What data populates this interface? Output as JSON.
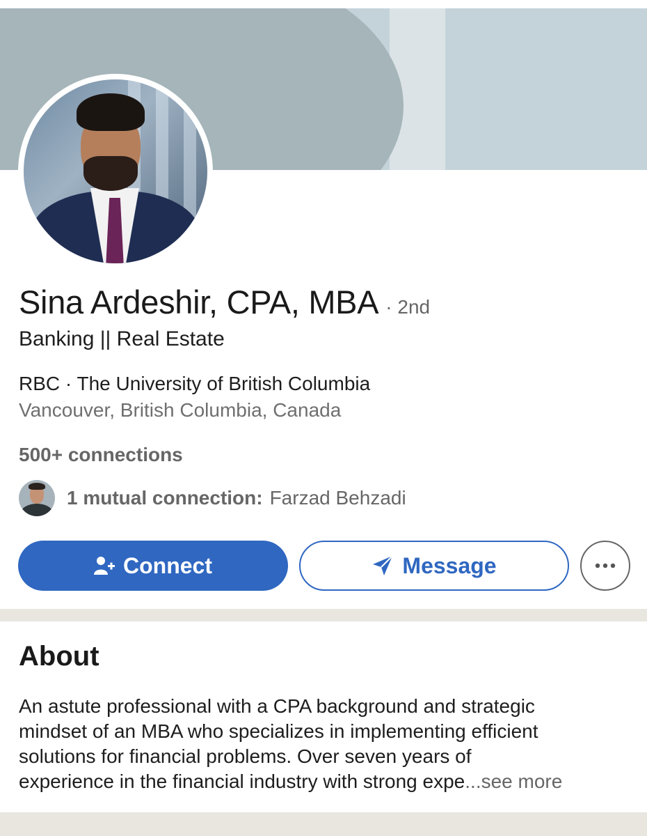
{
  "profile": {
    "name": "Sina Ardeshir, CPA, MBA",
    "degree": "· 2nd",
    "headline": "Banking || Real Estate",
    "company_line": "RBC · The University of British Columbia",
    "location": "Vancouver, British Columbia, Canada",
    "connections": "500+ connections",
    "mutual_label": "1 mutual connection:",
    "mutual_name": "Farzad Behzadi"
  },
  "actions": {
    "connect_label": "Connect",
    "message_label": "Message",
    "more_icon": "more-horizontal-icon"
  },
  "about": {
    "title": "About",
    "line1": "An astute professional with a CPA background and strategic",
    "line2": "mindset of an MBA who specializes in implementing efficient",
    "line3": "solutions for financial problems. Over seven years of",
    "line4": "experience in the financial industry with strong expe",
    "see_more": "...see more"
  },
  "colors": {
    "accent": "#2f67c1",
    "banner_dark": "#a5b5ba",
    "banner_light": "#c4d3da",
    "secondary_text": "#666666",
    "divider": "#e9e6e0"
  }
}
